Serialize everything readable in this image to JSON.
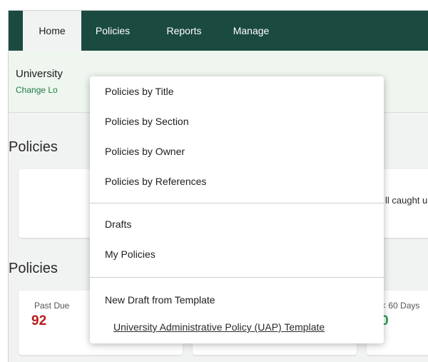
{
  "nav": {
    "tabs": [
      {
        "label": "Home"
      },
      {
        "label": "Policies"
      },
      {
        "label": "Reports"
      },
      {
        "label": "Manage"
      }
    ]
  },
  "site": {
    "name": "University",
    "change_link": "Change Lo"
  },
  "sections": {
    "policies_1_title": "Policies",
    "caught_up_text": "ll caught u",
    "policies_2_title": "Policies"
  },
  "stats": {
    "past_due_label": "Past Due",
    "past_due_value": "92",
    "sixty_days_label": "< 60 Days",
    "sixty_days_value": "0"
  },
  "dropdown": {
    "group1": [
      "Policies by Title",
      "Policies by Section",
      "Policies by Owner",
      "Policies by References"
    ],
    "group2": [
      "Drafts",
      "My Policies"
    ],
    "group3_heading": "New Draft from Template",
    "template_item": "University Administrative Policy (UAP) Template"
  },
  "colors": {
    "nav_bg": "#1b4a40",
    "accent_green": "#1e7a42",
    "past_due_red": "#b71c1c",
    "zero_green": "#1e9b4a"
  }
}
